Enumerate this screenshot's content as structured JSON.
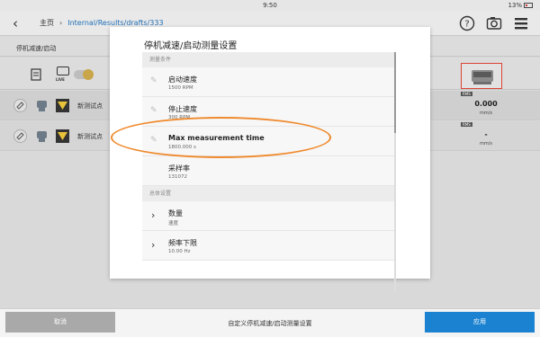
{
  "status": {
    "time": "9:50",
    "battery": "13%"
  },
  "header": {
    "breadcrumb_home": "主页",
    "breadcrumb_path": "Internal/Results/drafts/333",
    "icons": [
      "back-icon",
      "help-icon",
      "camera-settings-icon",
      "menu-icon"
    ]
  },
  "page": {
    "subtitle": "停机减速/启动",
    "live": "LIVE",
    "rows": [
      {
        "label": "新测试点",
        "rms": "RMS",
        "value": "0.000",
        "unit": "mm/s"
      },
      {
        "label": "新测试点",
        "rms": "RMS",
        "value": "-",
        "unit": "mm/s"
      }
    ]
  },
  "modal": {
    "title": "停机减速/启动测量设置",
    "section1": "测量条件",
    "items1": [
      {
        "label": "启动速度",
        "value": "1500 RPM"
      },
      {
        "label": "停止速度",
        "value": "300 RPM"
      },
      {
        "label": "Max measurement time",
        "value": "1800.000 s"
      },
      {
        "label": "采样率",
        "value": "131072"
      }
    ],
    "section2": "总体设置",
    "items2": [
      {
        "label": "数量",
        "value": "速度"
      },
      {
        "label": "频率下限",
        "value": "10.00 Hz"
      }
    ]
  },
  "footer": {
    "cancel": "取消",
    "title": "自定义停机减速/启动测量设置",
    "apply": "应用"
  },
  "colors": {
    "accent": "#1a82d0",
    "highlight": "#ef8a2e",
    "cancel": "#a9a9a9"
  }
}
